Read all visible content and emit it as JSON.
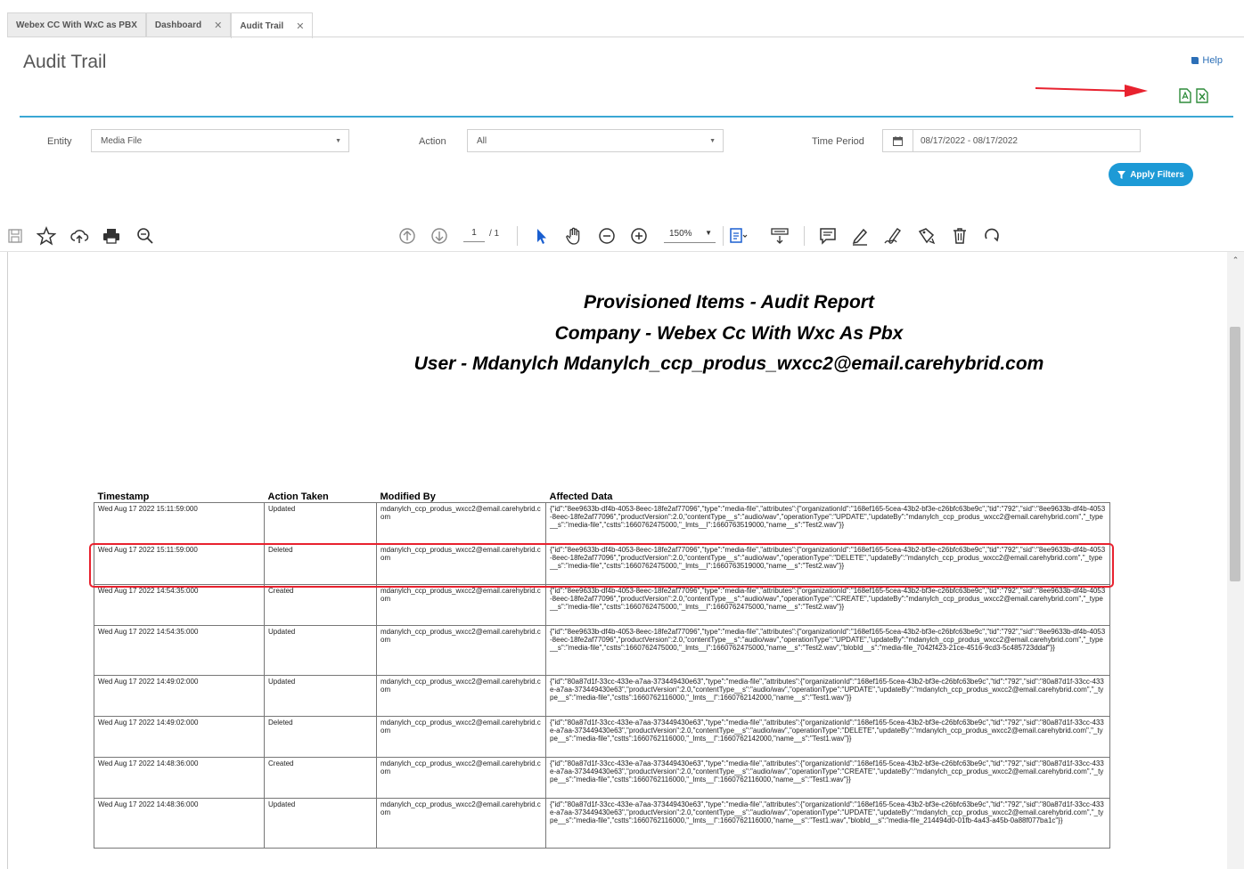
{
  "tabs": [
    {
      "label": "Webex CC With WxC as PBX",
      "closable": false
    },
    {
      "label": "Dashboard",
      "closable": true
    },
    {
      "label": "Audit Trail",
      "closable": true
    }
  ],
  "page": {
    "title": "Audit Trail",
    "help_label": "Help"
  },
  "filters": {
    "entity_label": "Entity",
    "entity_value": "Media File",
    "action_label": "Action",
    "action_value": "All",
    "time_period_label": "Time Period",
    "time_period_value": "08/17/2022 - 08/17/2022",
    "apply_label": "Apply Filters"
  },
  "colors": {
    "accent": "#1d9ad6",
    "highlight": "#e8222f",
    "arrow": "#e8222f"
  },
  "viewer": {
    "page_current": "1",
    "page_total": "/ 1",
    "zoom": "150%"
  },
  "report": {
    "title_line1": "Provisioned Items - Audit Report",
    "title_line2": "Company - Webex Cc With Wxc As Pbx",
    "title_line3": "User - Mdanylch Mdanylch_ccp_produs_wxcc2@email.carehybrid.com",
    "columns": [
      "Timestamp",
      "Action Taken",
      "Modified By",
      "Affected Data"
    ],
    "rows": [
      {
        "timestamp": "Wed Aug 17 2022 15:11:59:000",
        "action": "Updated",
        "modified_by": "mdanylch_ccp_produs_wxcc2@email.carehybrid.com",
        "data": "{\"id\":\"8ee9633b-df4b-4053-8eec-18fe2af77096\",\"type\":\"media-file\",\"attributes\":{\"organizationId\":\"168ef165-5cea-43b2-bf3e-c26bfc63be9c\",\"tid\":\"792\",\"sid\":\"8ee9633b-df4b-4053-8eec-18fe2af77096\",\"productVersion\":2.0,\"contentType__s\":\"audio/wav\",\"operationType\":\"UPDATE\",\"updateBy\":\"mdanylch_ccp_produs_wxcc2@email.carehybrid.com\",\"_type__s\":\"media-file\",\"cstts\":1660762475000,\"_lmts__l\":1660763519000,\"name__s\":\"Test2.wav\"}}"
      },
      {
        "timestamp": "Wed Aug 17 2022 15:11:59:000",
        "action": "Deleted",
        "modified_by": "mdanylch_ccp_produs_wxcc2@email.carehybrid.com",
        "data": "{\"id\":\"8ee9633b-df4b-4053-8eec-18fe2af77096\",\"type\":\"media-file\",\"attributes\":{\"organizationId\":\"168ef165-5cea-43b2-bf3e-c26bfc63be9c\",\"tid\":\"792\",\"sid\":\"8ee9633b-df4b-4053-8eec-18fe2af77096\",\"productVersion\":2.0,\"contentType__s\":\"audio/wav\",\"operationType\":\"DELETE\",\"updateBy\":\"mdanylch_ccp_produs_wxcc2@email.carehybrid.com\",\"_type__s\":\"media-file\",\"cstts\":1660762475000,\"_lmts__l\":1660763519000,\"name__s\":\"Test2.wav\"}}"
      },
      {
        "timestamp": "Wed Aug 17 2022 14:54:35:000",
        "action": "Created",
        "modified_by": "mdanylch_ccp_produs_wxcc2@email.carehybrid.com",
        "data": "{\"id\":\"8ee9633b-df4b-4053-8eec-18fe2af77096\",\"type\":\"media-file\",\"attributes\":{\"organizationId\":\"168ef165-5cea-43b2-bf3e-c26bfc63be9c\",\"tid\":\"792\",\"sid\":\"8ee9633b-df4b-4053-8eec-18fe2af77096\",\"productVersion\":2.0,\"contentType__s\":\"audio/wav\",\"operationType\":\"CREATE\",\"updateBy\":\"mdanylch_ccp_produs_wxcc2@email.carehybrid.com\",\"_type__s\":\"media-file\",\"cstts\":1660762475000,\"_lmts__l\":1660762475000,\"name__s\":\"Test2.wav\"}}"
      },
      {
        "timestamp": "Wed Aug 17 2022 14:54:35:000",
        "action": "Updated",
        "modified_by": "mdanylch_ccp_produs_wxcc2@email.carehybrid.com",
        "data": "{\"id\":\"8ee9633b-df4b-4053-8eec-18fe2af77096\",\"type\":\"media-file\",\"attributes\":{\"organizationId\":\"168ef165-5cea-43b2-bf3e-c26bfc63be9c\",\"tid\":\"792\",\"sid\":\"8ee9633b-df4b-4053-8eec-18fe2af77096\",\"productVersion\":2.0,\"contentType__s\":\"audio/wav\",\"operationType\":\"UPDATE\",\"updateBy\":\"mdanylch_ccp_produs_wxcc2@email.carehybrid.com\",\"_type__s\":\"media-file\",\"cstts\":1660762475000,\"_lmts__l\":1660762475000,\"name__s\":\"Test2.wav\",\"blobId__s\":\"media-file_7042f423-21ce-4516-9cd3-5c485723ddaf\"}}"
      },
      {
        "timestamp": "Wed Aug 17 2022 14:49:02:000",
        "action": "Updated",
        "modified_by": "mdanylch_ccp_produs_wxcc2@email.carehybrid.com",
        "data": "{\"id\":\"80a87d1f-33cc-433e-a7aa-373449430e63\",\"type\":\"media-file\",\"attributes\":{\"organizationId\":\"168ef165-5cea-43b2-bf3e-c26bfc63be9c\",\"tid\":\"792\",\"sid\":\"80a87d1f-33cc-433e-a7aa-373449430e63\",\"productVersion\":2.0,\"contentType__s\":\"audio/wav\",\"operationType\":\"UPDATE\",\"updateBy\":\"mdanylch_ccp_produs_wxcc2@email.carehybrid.com\",\"_type__s\":\"media-file\",\"cstts\":1660762116000,\"_lmts__l\":1660762142000,\"name__s\":\"Test1.wav\"}}"
      },
      {
        "timestamp": "Wed Aug 17 2022 14:49:02:000",
        "action": "Deleted",
        "modified_by": "mdanylch_ccp_produs_wxcc2@email.carehybrid.com",
        "data": "{\"id\":\"80a87d1f-33cc-433e-a7aa-373449430e63\",\"type\":\"media-file\",\"attributes\":{\"organizationId\":\"168ef165-5cea-43b2-bf3e-c26bfc63be9c\",\"tid\":\"792\",\"sid\":\"80a87d1f-33cc-433e-a7aa-373449430e63\",\"productVersion\":2.0,\"contentType__s\":\"audio/wav\",\"operationType\":\"DELETE\",\"updateBy\":\"mdanylch_ccp_produs_wxcc2@email.carehybrid.com\",\"_type__s\":\"media-file\",\"cstts\":1660762116000,\"_lmts__l\":1660762142000,\"name__s\":\"Test1.wav\"}}"
      },
      {
        "timestamp": "Wed Aug 17 2022 14:48:36:000",
        "action": "Created",
        "modified_by": "mdanylch_ccp_produs_wxcc2@email.carehybrid.com",
        "data": "{\"id\":\"80a87d1f-33cc-433e-a7aa-373449430e63\",\"type\":\"media-file\",\"attributes\":{\"organizationId\":\"168ef165-5cea-43b2-bf3e-c26bfc63be9c\",\"tid\":\"792\",\"sid\":\"80a87d1f-33cc-433e-a7aa-373449430e63\",\"productVersion\":2.0,\"contentType__s\":\"audio/wav\",\"operationType\":\"CREATE\",\"updateBy\":\"mdanylch_ccp_produs_wxcc2@email.carehybrid.com\",\"_type__s\":\"media-file\",\"cstts\":1660762116000,\"_lmts__l\":1660762116000,\"name__s\":\"Test1.wav\"}}"
      },
      {
        "timestamp": "Wed Aug 17 2022 14:48:36:000",
        "action": "Updated",
        "modified_by": "mdanylch_ccp_produs_wxcc2@email.carehybrid.com",
        "data": "{\"id\":\"80a87d1f-33cc-433e-a7aa-373449430e63\",\"type\":\"media-file\",\"attributes\":{\"organizationId\":\"168ef165-5cea-43b2-bf3e-c26bfc63be9c\",\"tid\":\"792\",\"sid\":\"80a87d1f-33cc-433e-a7aa-373449430e63\",\"productVersion\":2.0,\"contentType__s\":\"audio/wav\",\"operationType\":\"UPDATE\",\"updateBy\":\"mdanylch_ccp_produs_wxcc2@email.carehybrid.com\",\"_type__s\":\"media-file\",\"cstts\":1660762116000,\"_lmts__l\":1660762116000,\"name__s\":\"Test1.wav\",\"blobId__s\":\"media-file_214494d0-01fb-4a43-a45b-0a88f077ba1c\"}}"
      }
    ]
  }
}
